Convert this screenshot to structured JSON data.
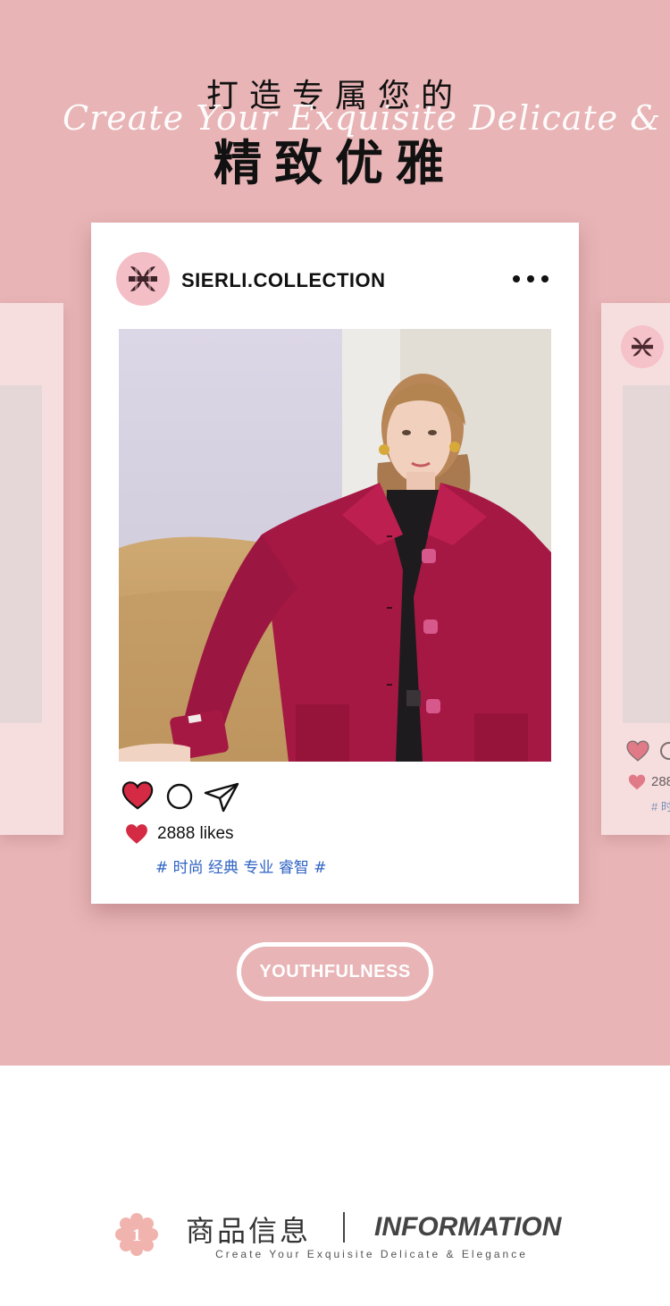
{
  "header": {
    "title_line1": "打造专属您的",
    "script_text": "Create Your Exquisite Delicate & Elegance",
    "title_line2": "精致优雅"
  },
  "post": {
    "handle": "SIERLI.COLLECTION",
    "likes_text": "2888 likes",
    "tags_text": "# 时尚 经典 专业 睿智 #",
    "photo_alt": "model wearing magenta wool coat"
  },
  "side_post": {
    "likes_text": "288",
    "tags_text": "# 时"
  },
  "pill": {
    "label": "YOUTHFULNESS"
  },
  "info": {
    "badge_number": "1",
    "title_cn": "商品信息",
    "title_en": "INFORMATION",
    "subtitle": "Create Your Exquisite Delicate & Elegance"
  },
  "colors": {
    "hero_bg": "#e8b4b6",
    "accent_heart": "#d42a43",
    "tag_blue": "#2f63c3",
    "avatar_pink": "#f4bec6"
  },
  "icons": [
    "brand-logo-icon",
    "more-dots-icon",
    "heart-icon",
    "comment-icon",
    "share-icon",
    "flower-badge-icon"
  ]
}
